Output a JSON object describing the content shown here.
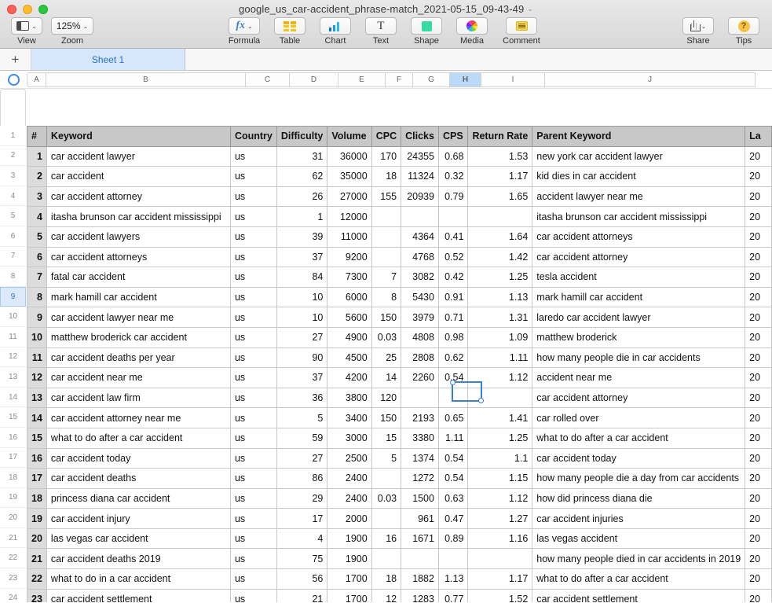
{
  "window": {
    "title": "google_us_car-accident_phrase-match_2021-05-15_09-43-49",
    "title_chevron": "⌄",
    "traffic": {
      "close": "close-button",
      "minimize": "minimize-button",
      "zoom": "maximize-button"
    }
  },
  "toolbar": {
    "left": [
      {
        "name": "view",
        "label": "View",
        "icon": "view-icon",
        "chevron": "⌄"
      },
      {
        "name": "zoom",
        "label": "Zoom",
        "value": "125%",
        "chevron": "⌄"
      }
    ],
    "middle": [
      {
        "name": "formula",
        "label": "Formula",
        "icon": "fx-icon",
        "glyph": "fx",
        "chevron": "⌄"
      },
      {
        "name": "table",
        "label": "Table",
        "icon": "table-icon"
      },
      {
        "name": "chart",
        "label": "Chart",
        "icon": "chart-icon"
      },
      {
        "name": "text",
        "label": "Text",
        "icon": "text-icon",
        "glyph": "T"
      },
      {
        "name": "shape",
        "label": "Shape",
        "icon": "shape-icon"
      },
      {
        "name": "media",
        "label": "Media",
        "icon": "media-icon"
      },
      {
        "name": "comment",
        "label": "Comment",
        "icon": "comment-icon"
      }
    ],
    "right": [
      {
        "name": "share",
        "label": "Share",
        "icon": "share-icon",
        "chevron": "⌄"
      },
      {
        "name": "tips",
        "label": "Tips",
        "icon": "tips-icon",
        "glyph": "?"
      }
    ]
  },
  "tabbar": {
    "add_label": "+",
    "sheets": [
      {
        "label": "Sheet 1",
        "active": true
      }
    ]
  },
  "columns_bar": {
    "letters": [
      "A",
      "B",
      "C",
      "D",
      "E",
      "F",
      "G",
      "H",
      "I",
      "J"
    ],
    "selected": "H"
  },
  "row_numbers": [
    "1",
    "2",
    "3",
    "4",
    "5",
    "6",
    "7",
    "8",
    "9",
    "10",
    "11",
    "12",
    "13",
    "14",
    "15",
    "16",
    "17",
    "18",
    "19",
    "20",
    "21",
    "22",
    "23",
    "24"
  ],
  "selected_row_number": "9",
  "selected_cell": {
    "ref": "H9",
    "value": "0.91"
  },
  "sheet": {
    "headers": [
      "#",
      "Keyword",
      "Country",
      "Difficulty",
      "Volume",
      "CPC",
      "Clicks",
      "CPS",
      "Return Rate",
      "Parent Keyword",
      "La"
    ],
    "rows": [
      {
        "idx": "1",
        "keyword": "car accident lawyer",
        "country": "us",
        "difficulty": "31",
        "volume": "36000",
        "cpc": "170",
        "clicks": "24355",
        "cps": "0.68",
        "return_rate": "1.53",
        "parent": "new york car accident lawyer",
        "la": "20"
      },
      {
        "idx": "2",
        "keyword": "car accident",
        "country": "us",
        "difficulty": "62",
        "volume": "35000",
        "cpc": "18",
        "clicks": "11324",
        "cps": "0.32",
        "return_rate": "1.17",
        "parent": "kid dies in car accident",
        "la": "20"
      },
      {
        "idx": "3",
        "keyword": "car accident attorney",
        "country": "us",
        "difficulty": "26",
        "volume": "27000",
        "cpc": "155",
        "clicks": "20939",
        "cps": "0.79",
        "return_rate": "1.65",
        "parent": "accident lawyer near me",
        "la": "20"
      },
      {
        "idx": "4",
        "keyword": "itasha brunson car accident mississippi",
        "country": "us",
        "difficulty": "1",
        "volume": "12000",
        "cpc": "",
        "clicks": "",
        "cps": "",
        "return_rate": "",
        "parent": "itasha brunson car accident mississippi",
        "la": "20"
      },
      {
        "idx": "5",
        "keyword": "car accident lawyers",
        "country": "us",
        "difficulty": "39",
        "volume": "11000",
        "cpc": "",
        "clicks": "4364",
        "cps": "0.41",
        "return_rate": "1.64",
        "parent": "car accident attorneys",
        "la": "20"
      },
      {
        "idx": "6",
        "keyword": "car accident attorneys",
        "country": "us",
        "difficulty": "37",
        "volume": "9200",
        "cpc": "",
        "clicks": "4768",
        "cps": "0.52",
        "return_rate": "1.42",
        "parent": "car accident attorney",
        "la": "20"
      },
      {
        "idx": "7",
        "keyword": "fatal car accident",
        "country": "us",
        "difficulty": "84",
        "volume": "7300",
        "cpc": "7",
        "clicks": "3082",
        "cps": "0.42",
        "return_rate": "1.25",
        "parent": "tesla accident",
        "la": "20"
      },
      {
        "idx": "8",
        "keyword": "mark hamill car accident",
        "country": "us",
        "difficulty": "10",
        "volume": "6000",
        "cpc": "8",
        "clicks": "5430",
        "cps": "0.91",
        "return_rate": "1.13",
        "parent": "mark hamill car accident",
        "la": "20"
      },
      {
        "idx": "9",
        "keyword": "car accident lawyer near me",
        "country": "us",
        "difficulty": "10",
        "volume": "5600",
        "cpc": "150",
        "clicks": "3979",
        "cps": "0.71",
        "return_rate": "1.31",
        "parent": "laredo car accident lawyer",
        "la": "20"
      },
      {
        "idx": "10",
        "keyword": "matthew broderick car accident",
        "country": "us",
        "difficulty": "27",
        "volume": "4900",
        "cpc": "0.03",
        "clicks": "4808",
        "cps": "0.98",
        "return_rate": "1.09",
        "parent": "matthew broderick",
        "la": "20"
      },
      {
        "idx": "11",
        "keyword": "car accident deaths per year",
        "country": "us",
        "difficulty": "90",
        "volume": "4500",
        "cpc": "25",
        "clicks": "2808",
        "cps": "0.62",
        "return_rate": "1.11",
        "parent": "how many people die in car accidents",
        "la": "20"
      },
      {
        "idx": "12",
        "keyword": "car accident near me",
        "country": "us",
        "difficulty": "37",
        "volume": "4200",
        "cpc": "14",
        "clicks": "2260",
        "cps": "0.54",
        "return_rate": "1.12",
        "parent": "accident near me",
        "la": "20"
      },
      {
        "idx": "13",
        "keyword": "car accident law firm",
        "country": "us",
        "difficulty": "36",
        "volume": "3800",
        "cpc": "120",
        "clicks": "",
        "cps": "",
        "return_rate": "",
        "parent": "car accident attorney",
        "la": "20"
      },
      {
        "idx": "14",
        "keyword": "car accident attorney near me",
        "country": "us",
        "difficulty": "5",
        "volume": "3400",
        "cpc": "150",
        "clicks": "2193",
        "cps": "0.65",
        "return_rate": "1.41",
        "parent": "car rolled over",
        "la": "20"
      },
      {
        "idx": "15",
        "keyword": "what to do after a car accident",
        "country": "us",
        "difficulty": "59",
        "volume": "3000",
        "cpc": "15",
        "clicks": "3380",
        "cps": "1.11",
        "return_rate": "1.25",
        "parent": "what to do after a car accident",
        "la": "20"
      },
      {
        "idx": "16",
        "keyword": "car accident today",
        "country": "us",
        "difficulty": "27",
        "volume": "2500",
        "cpc": "5",
        "clicks": "1374",
        "cps": "0.54",
        "return_rate": "1.1",
        "parent": "car accident today",
        "la": "20"
      },
      {
        "idx": "17",
        "keyword": "car accident deaths",
        "country": "us",
        "difficulty": "86",
        "volume": "2400",
        "cpc": "",
        "clicks": "1272",
        "cps": "0.54",
        "return_rate": "1.15",
        "parent": "how many people die a day from car accidents",
        "la": "20"
      },
      {
        "idx": "18",
        "keyword": "princess diana car accident",
        "country": "us",
        "difficulty": "29",
        "volume": "2400",
        "cpc": "0.03",
        "clicks": "1500",
        "cps": "0.63",
        "return_rate": "1.12",
        "parent": "how did princess diana die",
        "la": "20"
      },
      {
        "idx": "19",
        "keyword": "car accident injury",
        "country": "us",
        "difficulty": "17",
        "volume": "2000",
        "cpc": "",
        "clicks": "961",
        "cps": "0.47",
        "return_rate": "1.27",
        "parent": "car accident injuries",
        "la": "20"
      },
      {
        "idx": "20",
        "keyword": "las vegas car accident",
        "country": "us",
        "difficulty": "4",
        "volume": "1900",
        "cpc": "16",
        "clicks": "1671",
        "cps": "0.89",
        "return_rate": "1.16",
        "parent": "las vegas accident",
        "la": "20"
      },
      {
        "idx": "21",
        "keyword": "car accident deaths 2019",
        "country": "us",
        "difficulty": "75",
        "volume": "1900",
        "cpc": "",
        "clicks": "",
        "cps": "",
        "return_rate": "",
        "parent": "how many people died in car accidents in 2019",
        "la": "20"
      },
      {
        "idx": "22",
        "keyword": "what to do in a car accident",
        "country": "us",
        "difficulty": "56",
        "volume": "1700",
        "cpc": "18",
        "clicks": "1882",
        "cps": "1.13",
        "return_rate": "1.17",
        "parent": "what to do after a car accident",
        "la": "20"
      },
      {
        "idx": "23",
        "keyword": "car accident settlement",
        "country": "us",
        "difficulty": "21",
        "volume": "1700",
        "cpc": "12",
        "clicks": "1283",
        "cps": "0.77",
        "return_rate": "1.52",
        "parent": "car accident settlement",
        "la": "20"
      }
    ]
  },
  "colors": {
    "accent": "#3b7fd4",
    "header_bg": "#c8c8c8",
    "index_bg": "#dcdcdc",
    "tab_active": "#d6e6fb",
    "selection": "#bdd9fa"
  }
}
